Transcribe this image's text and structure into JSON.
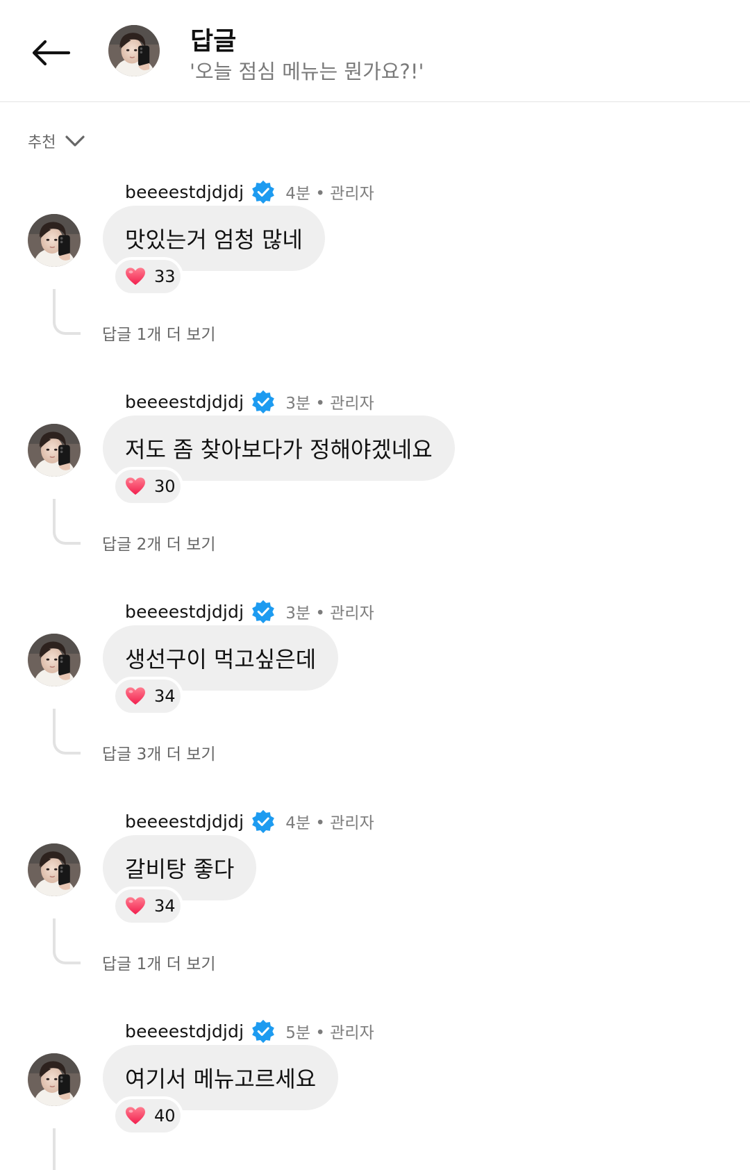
{
  "header": {
    "back_icon": "arrow-left-icon",
    "title": "답글",
    "subtitle": "'오늘 점심 메뉴는 뭔가요?!'"
  },
  "sort": {
    "label": "추천",
    "icon": "chevron-down-icon"
  },
  "colors": {
    "verified": "#1d9bf0",
    "heart": "#ff3b63",
    "bubble": "#efefef"
  },
  "comments": [
    {
      "user": "beeeestdjdjdj",
      "time": "4분 • 관리자",
      "text": "맛있는거 엄청 많네",
      "likes": "33",
      "more": "답글 1개 더 보기"
    },
    {
      "user": "beeeestdjdjdj",
      "time": "3분 • 관리자",
      "text": "저도 좀 찾아보다가 정해야겠네요",
      "likes": "30",
      "more": "답글 2개 더 보기"
    },
    {
      "user": "beeeestdjdjdj",
      "time": "3분 • 관리자",
      "text": "생선구이 먹고싶은데",
      "likes": "34",
      "more": "답글 3개 더 보기"
    },
    {
      "user": "beeeestdjdjdj",
      "time": "4분 • 관리자",
      "text": "갈비탕 좋다",
      "likes": "34",
      "more": "답글 1개 더 보기"
    },
    {
      "user": "beeeestdjdjdj",
      "time": "5분 • 관리자",
      "text": "여기서 메뉴고르세요",
      "likes": "40"
    }
  ]
}
